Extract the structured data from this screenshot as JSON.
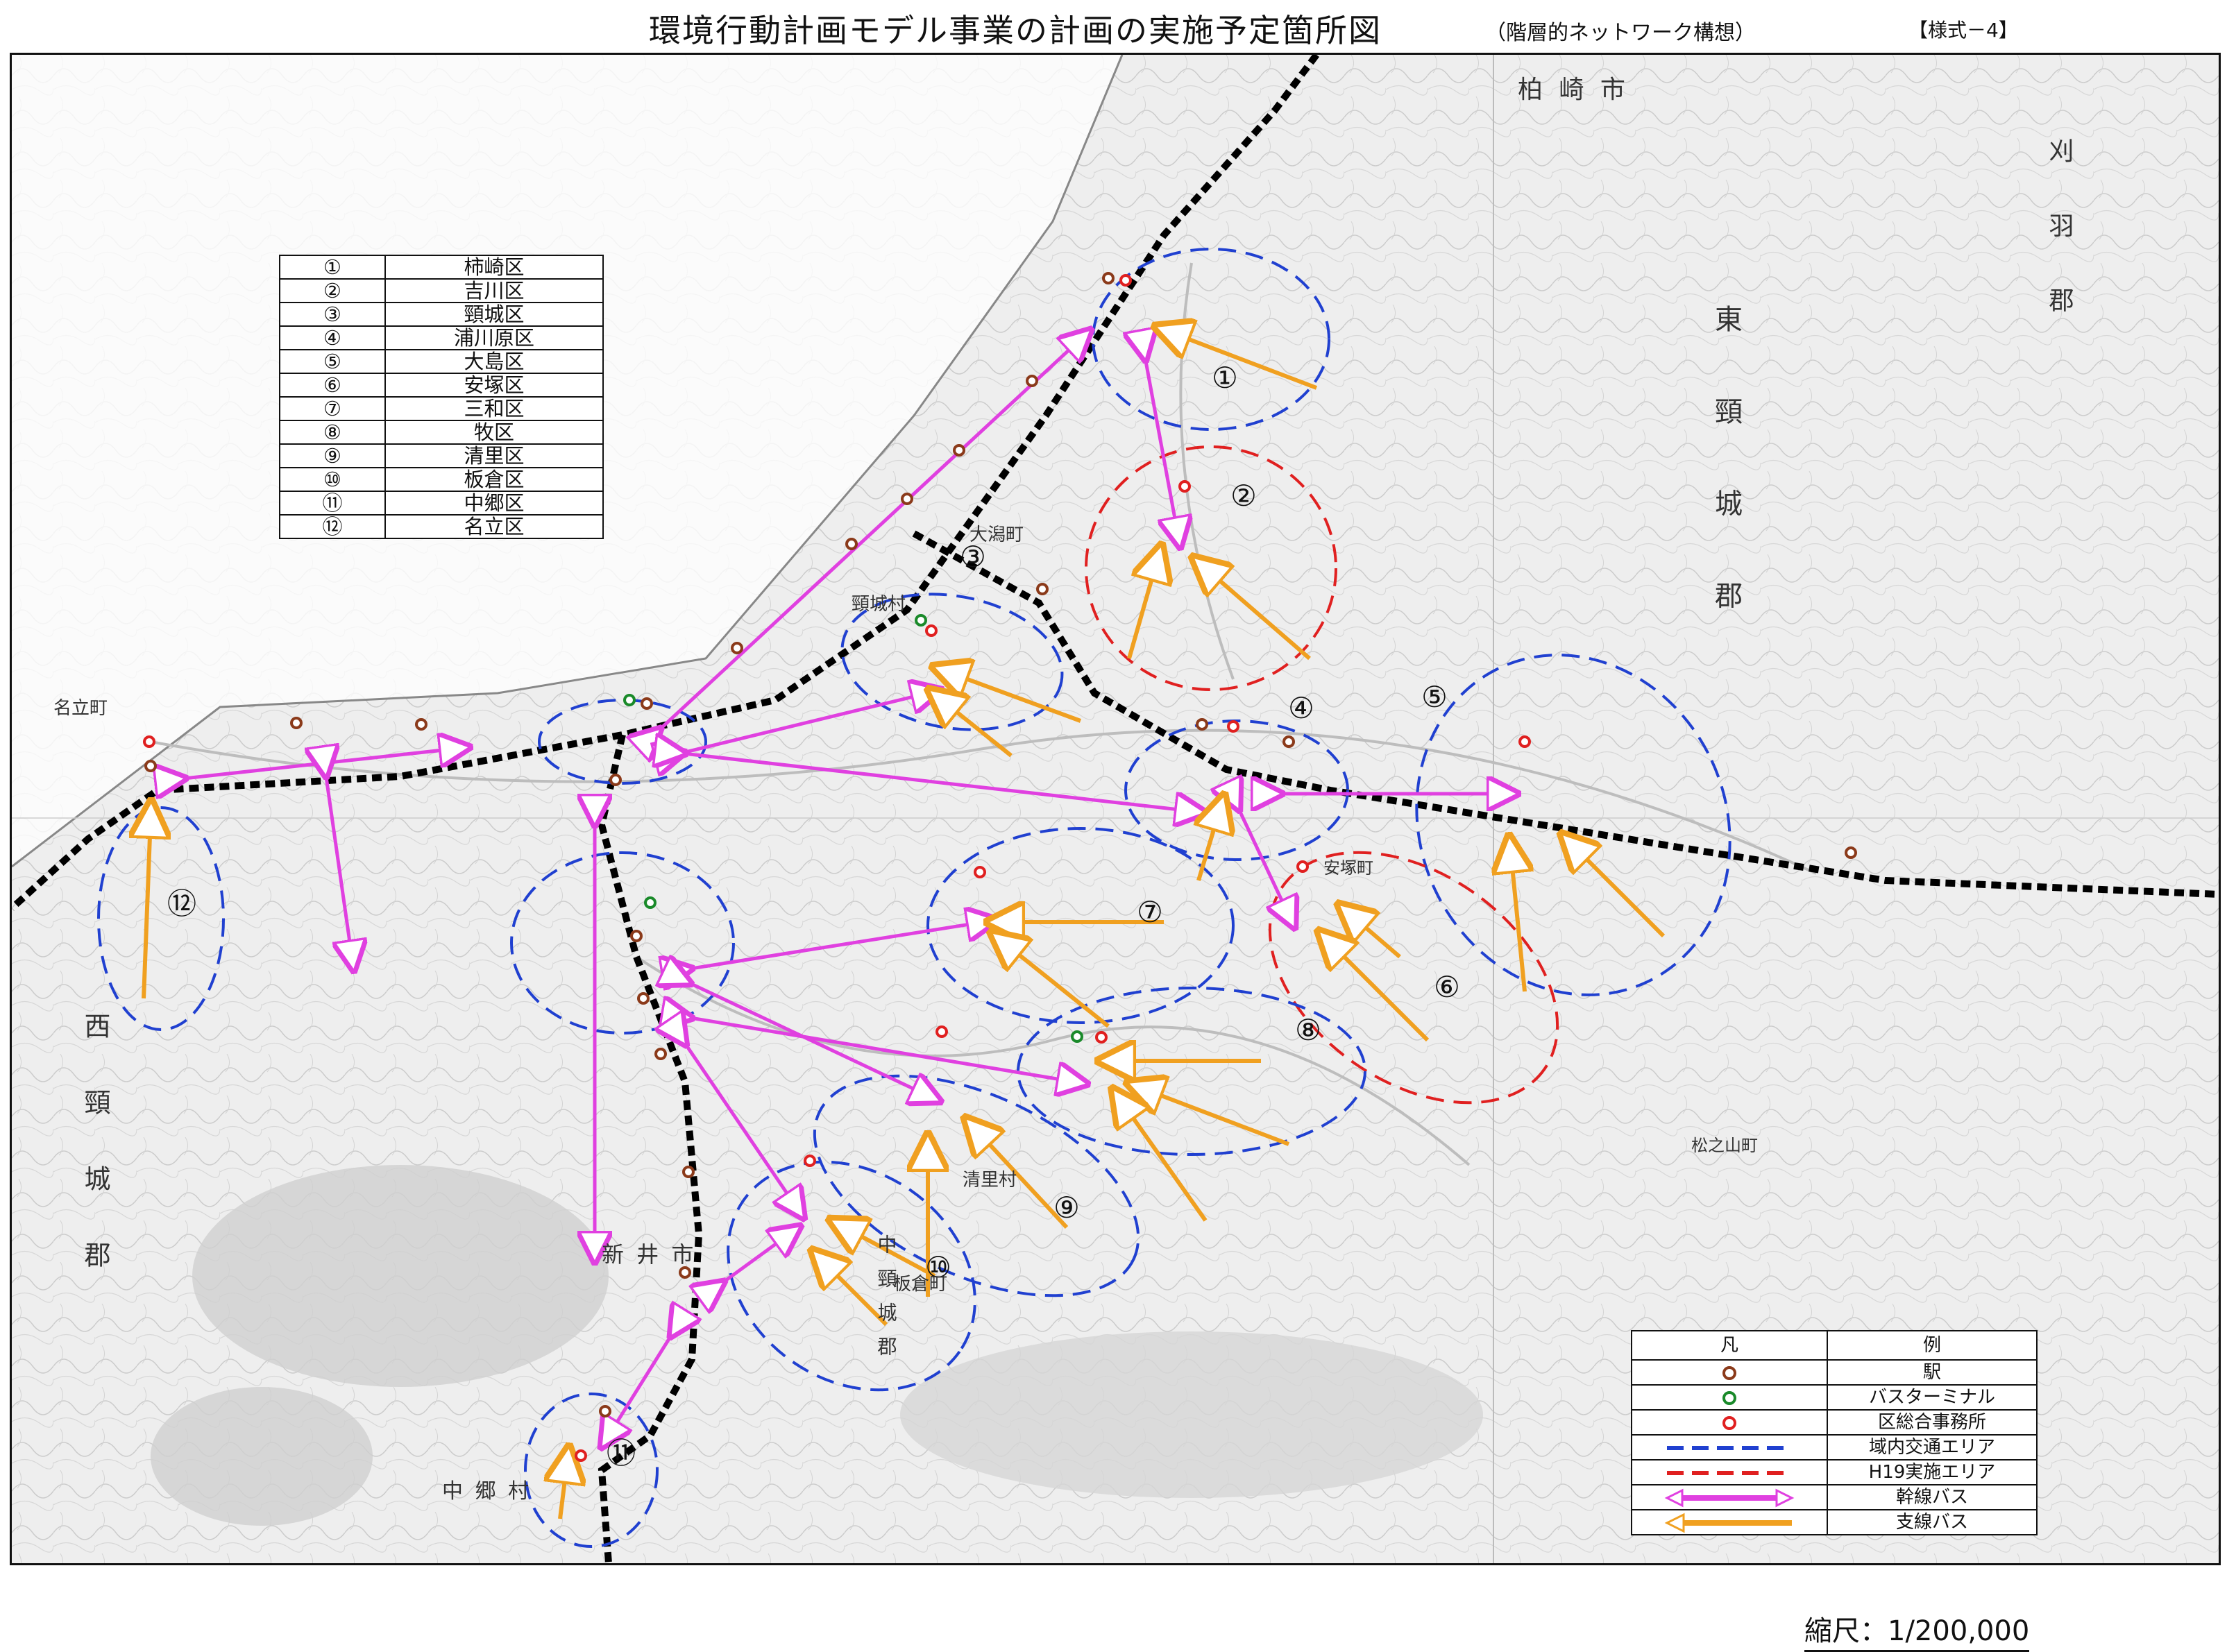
{
  "header": {
    "title": "環境行動計画モデル事業の計画の実施予定箇所図",
    "subtitle": "（階層的ネットワーク構想）",
    "form_no": "【様式－4】"
  },
  "district_table": {
    "rows": [
      {
        "num": "①",
        "name": "柿崎区"
      },
      {
        "num": "②",
        "name": "吉川区"
      },
      {
        "num": "③",
        "name": "頸城区"
      },
      {
        "num": "④",
        "name": "浦川原区"
      },
      {
        "num": "⑤",
        "name": "大島区"
      },
      {
        "num": "⑥",
        "name": "安塚区"
      },
      {
        "num": "⑦",
        "name": "三和区"
      },
      {
        "num": "⑧",
        "name": "牧区"
      },
      {
        "num": "⑨",
        "name": "清里区"
      },
      {
        "num": "⑩",
        "name": "板倉区"
      },
      {
        "num": "⑪",
        "name": "中郷区"
      },
      {
        "num": "⑫",
        "name": "名立区"
      }
    ]
  },
  "map": {
    "place_labels": [
      {
        "id": "kashiwazaki-city",
        "text": "柏 崎 市"
      },
      {
        "id": "higashikubiki-gun",
        "text": "東 頸 城 郡"
      },
      {
        "id": "kariwa-gun",
        "text": "刈 羽 郡"
      },
      {
        "id": "nishikubiki-gun",
        "text": "西 頸 城 郡"
      },
      {
        "id": "nakakubiki-gun",
        "text": "中 頸 城 郡"
      },
      {
        "id": "arai-city",
        "text": "新 井 市"
      },
      {
        "id": "nakago-village",
        "text": "中 郷 村"
      },
      {
        "id": "nadachi-town",
        "text": "名立町"
      },
      {
        "id": "ogata-town",
        "text": "大潟町"
      },
      {
        "id": "kubiki-village",
        "text": "頸城村"
      },
      {
        "id": "kiyosato-village",
        "text": "清里村"
      },
      {
        "id": "itakura-town",
        "text": "板倉町"
      },
      {
        "id": "yasuzuka-town",
        "text": "安塚町"
      },
      {
        "id": "matsunoyama-town",
        "text": "松之山町"
      }
    ],
    "area_numbers": [
      "①",
      "②",
      "③",
      "④",
      "⑤",
      "⑥",
      "⑦",
      "⑧",
      "⑨",
      "⑩",
      "⑪",
      "⑫"
    ]
  },
  "legend": {
    "header": [
      "凡",
      "例"
    ],
    "items": [
      {
        "symbol": "brown-circle",
        "label": "駅"
      },
      {
        "symbol": "green-circle",
        "label": "バスターミナル"
      },
      {
        "symbol": "red-circle",
        "label": "区総合事務所"
      },
      {
        "symbol": "blue-dashed",
        "label": "域内交通エリア"
      },
      {
        "symbol": "red-dashed",
        "label": "H19実施エリア"
      },
      {
        "symbol": "magenta-double-arrow",
        "label": "幹線バス"
      },
      {
        "symbol": "orange-arrow",
        "label": "支線バス"
      }
    ]
  },
  "colors": {
    "station": "#8b3a1a",
    "bus_terminal": "#1a8a2a",
    "office": "#e02020",
    "area_blue": "#2040d0",
    "area_red": "#e02020",
    "trunk_bus": "#e040e0",
    "branch_bus": "#f0a020"
  },
  "scale": {
    "label": "縮尺：1/200,000"
  }
}
